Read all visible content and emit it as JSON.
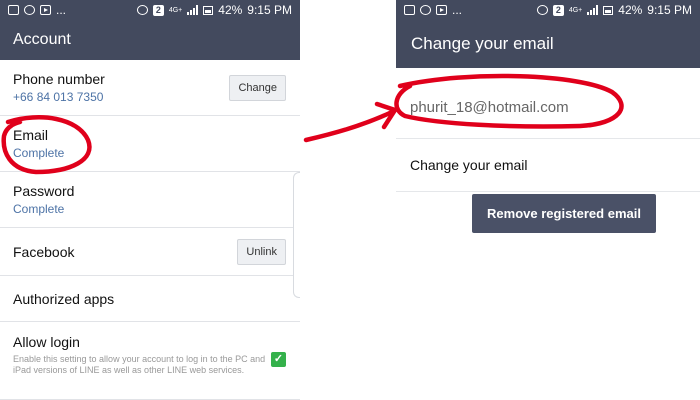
{
  "status_bar": {
    "left_icons": [
      "image-icon",
      "contact-icon",
      "play-store-icon",
      "more-dots-icon"
    ],
    "more_text": "...",
    "badge": "2",
    "network": "4G+",
    "battery": "42%",
    "time": "9:15 PM"
  },
  "left_screen": {
    "title": "Account",
    "rows": [
      {
        "title": "Phone number",
        "sub": "+66 84 013 7350",
        "button": "Change"
      },
      {
        "title": "Email",
        "sub": "Complete"
      },
      {
        "title": "Password",
        "sub": "Complete"
      },
      {
        "title": "Facebook",
        "button": "Unlink"
      },
      {
        "title": "Authorized apps"
      },
      {
        "title": "Allow login",
        "desc": "Enable this setting to allow your account to log in to the PC and iPad versions of LINE as well as other LINE web services.",
        "checked": true
      }
    ]
  },
  "right_screen": {
    "title": "Change your email",
    "email": "phurit_18@hotmail.com",
    "change_label": "Change your email",
    "remove_button": "Remove registered email"
  },
  "annotation_color": "#e0001b",
  "accent_color": "#434a5e",
  "link_color": "#4d73a6",
  "check_color": "#34b14b"
}
